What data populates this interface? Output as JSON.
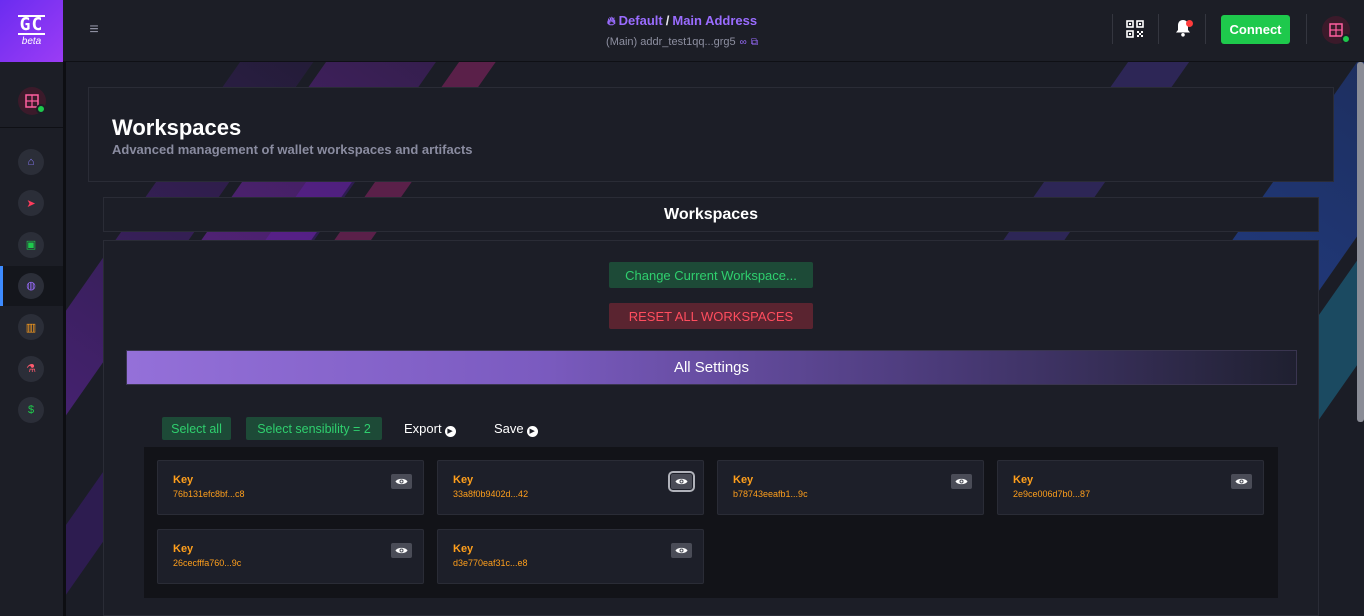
{
  "app": {
    "logo_text": "GC",
    "logo_sub": "beta"
  },
  "header": {
    "breadcrumb_root": "Default",
    "breadcrumb_sep": "/",
    "breadcrumb_current": "Main Address",
    "address": "(Main) addr_test1qq...grg5",
    "connect_label": "Connect"
  },
  "sidebar": {
    "items": [
      {
        "icon": "home-icon",
        "glyph": "⌂",
        "color": "#8a7cff"
      },
      {
        "icon": "send-icon",
        "glyph": "➤",
        "color": "#ff3b5c"
      },
      {
        "icon": "gift-icon",
        "glyph": "▣",
        "color": "#1ec94c"
      },
      {
        "icon": "globe-icon",
        "glyph": "◍",
        "color": "#9a6cff"
      },
      {
        "icon": "factory-icon",
        "glyph": "▥",
        "color": "#ff9f1c"
      },
      {
        "icon": "flask-icon",
        "glyph": "⚗",
        "color": "#ff5a6e"
      },
      {
        "icon": "money-icon",
        "glyph": "$",
        "color": "#1ec94c"
      }
    ],
    "active_index": 3
  },
  "page": {
    "title": "Workspaces",
    "subtitle": "Advanced management of wallet workspaces and artifacts",
    "section_title": "Workspaces",
    "change_workspace_label": "Change Current Workspace...",
    "reset_label": "RESET ALL WORKSPACES",
    "settings_title": "All Settings",
    "select_all_label": "Select all",
    "select_sensibility_label": "Select sensibility = 2",
    "export_label": "Export",
    "save_label": "Save"
  },
  "keys": [
    {
      "label": "Key",
      "value": "76b131efc8bf...c8"
    },
    {
      "label": "Key",
      "value": "33a8f0b9402d...42"
    },
    {
      "label": "Key",
      "value": "b78743eeafb1...9c"
    },
    {
      "label": "Key",
      "value": "2e9ce006d7b0...87"
    },
    {
      "label": "Key",
      "value": "26cecfffa760...9c"
    },
    {
      "label": "Key",
      "value": "d3e770eaf31c...e8"
    }
  ],
  "colors": {
    "accent": "#9a6cff",
    "connect": "#1ec94c",
    "key_text": "#ff9f1c",
    "reset_text": "#ff4d5e"
  }
}
